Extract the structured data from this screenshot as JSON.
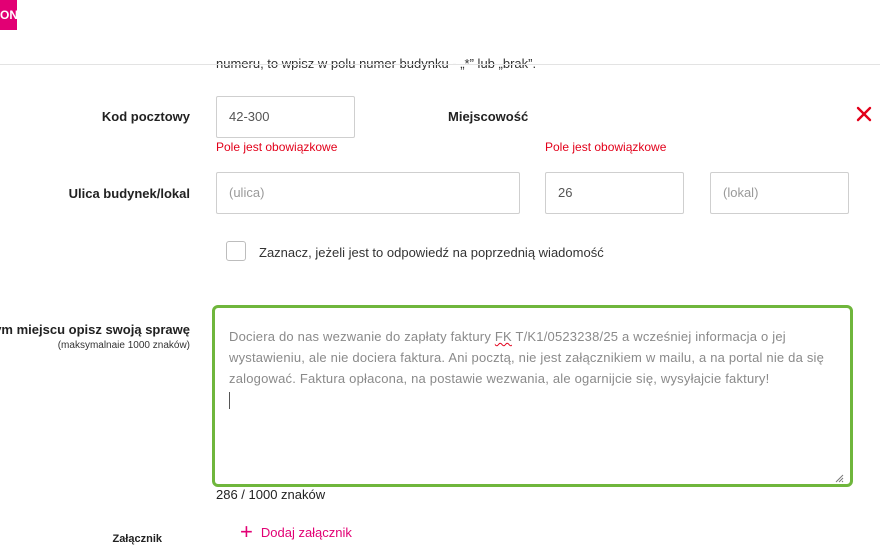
{
  "header": {
    "badge_text": "ON"
  },
  "hint": {
    "text": "numeru, to wpisz w polu numer budynku - „*” lub „brak”."
  },
  "postal": {
    "label": "Kod pocztowy",
    "value": "42-300",
    "error": "Pole jest obowiązkowe"
  },
  "city": {
    "label": "Miejscowość",
    "error": "Pole jest obowiązkowe"
  },
  "street": {
    "label": "Ulica budynek/lokal",
    "street_placeholder": "(ulica)",
    "building_value": "26",
    "unit_placeholder": "(lokal)"
  },
  "reply_checkbox": {
    "label": "Zaznacz, jeżeli jest to odpowiedź na poprzednią wiadomość"
  },
  "description": {
    "label": "W tym miejscu opisz swoją sprawę",
    "sublabel": "(maksymalnaie 1000 znaków)",
    "text_before": "Dociera do nas wezwanie do zapłaty faktury ",
    "text_flagged": "FK",
    "text_after": " T/K1/0523238/25 a wcześniej informacja o jej wystawieniu, ale nie dociera faktura. Ani pocztą, nie jest załącznikiem w mailu, a na portal nie da się zalogować. Faktura opłacona, na postawie wezwania, ale ogarnijcie się, wysyłajcie faktury!",
    "counter": "286 / 1000 znaków"
  },
  "attachment": {
    "label": "Załącznik",
    "add_label": "Dodaj załącznik"
  },
  "colors": {
    "brand": "#e20074",
    "error": "#e2001a",
    "focus_border": "#6fb63c"
  },
  "icons": {
    "close": "close-icon",
    "plus": "plus-icon",
    "resize": "resize-grip-icon"
  }
}
